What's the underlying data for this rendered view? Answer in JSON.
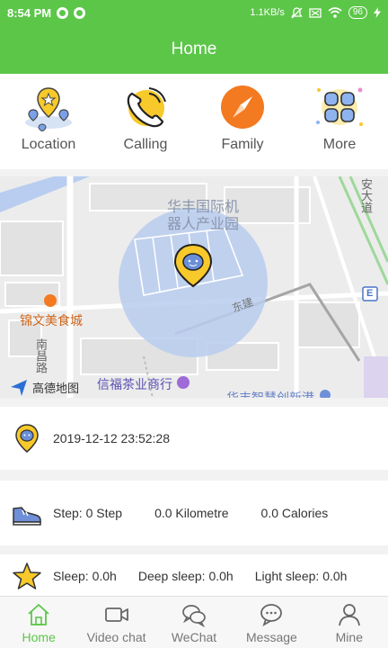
{
  "status_bar": {
    "time": "8:54 PM",
    "network_speed": "1.1KB/s",
    "battery": "96"
  },
  "header": {
    "title": "Home"
  },
  "quick_menu": [
    {
      "label": "Location",
      "icon": "location-pins-icon"
    },
    {
      "label": "Calling",
      "icon": "phone-icon"
    },
    {
      "label": "Family",
      "icon": "compass-icon"
    },
    {
      "label": "More",
      "icon": "grid-icon"
    }
  ],
  "map": {
    "labels": {
      "industrial_park_line1": "华丰国际机",
      "industrial_park_line2": "器人产业园",
      "restaurant": "锦文美食城",
      "road_south": "南昌路",
      "tea_shop": "信福茶业商行",
      "road_east": "东建",
      "amap_logo": "高德地图",
      "bottom_cut": "华丰智慧创新港",
      "top_right_cut": "安大道",
      "exit_marker": "E"
    }
  },
  "location_card": {
    "datetime": "2019-12-12 23:52:28"
  },
  "steps_card": {
    "step": "Step: 0 Step",
    "distance": "0.0 Kilometre",
    "calories": "0.0 Calories"
  },
  "sleep_card": {
    "sleep": "Sleep: 0.0h",
    "deep_sleep": "Deep sleep: 0.0h",
    "light_sleep": "Light sleep: 0.0h"
  },
  "tab_bar": [
    {
      "label": "Home",
      "icon": "home-icon",
      "active": true
    },
    {
      "label": "Video chat",
      "icon": "video-camera-icon",
      "active": false
    },
    {
      "label": "WeChat",
      "icon": "chat-bubbles-icon",
      "active": false
    },
    {
      "label": "Message",
      "icon": "message-bubble-icon",
      "active": false
    },
    {
      "label": "Mine",
      "icon": "person-icon",
      "active": false
    }
  ],
  "colors": {
    "brand_green": "#5cc649",
    "map_radius_fill": "#b9cdee",
    "marker_yellow": "#f7c92a",
    "compass_orange": "#f37a21"
  }
}
